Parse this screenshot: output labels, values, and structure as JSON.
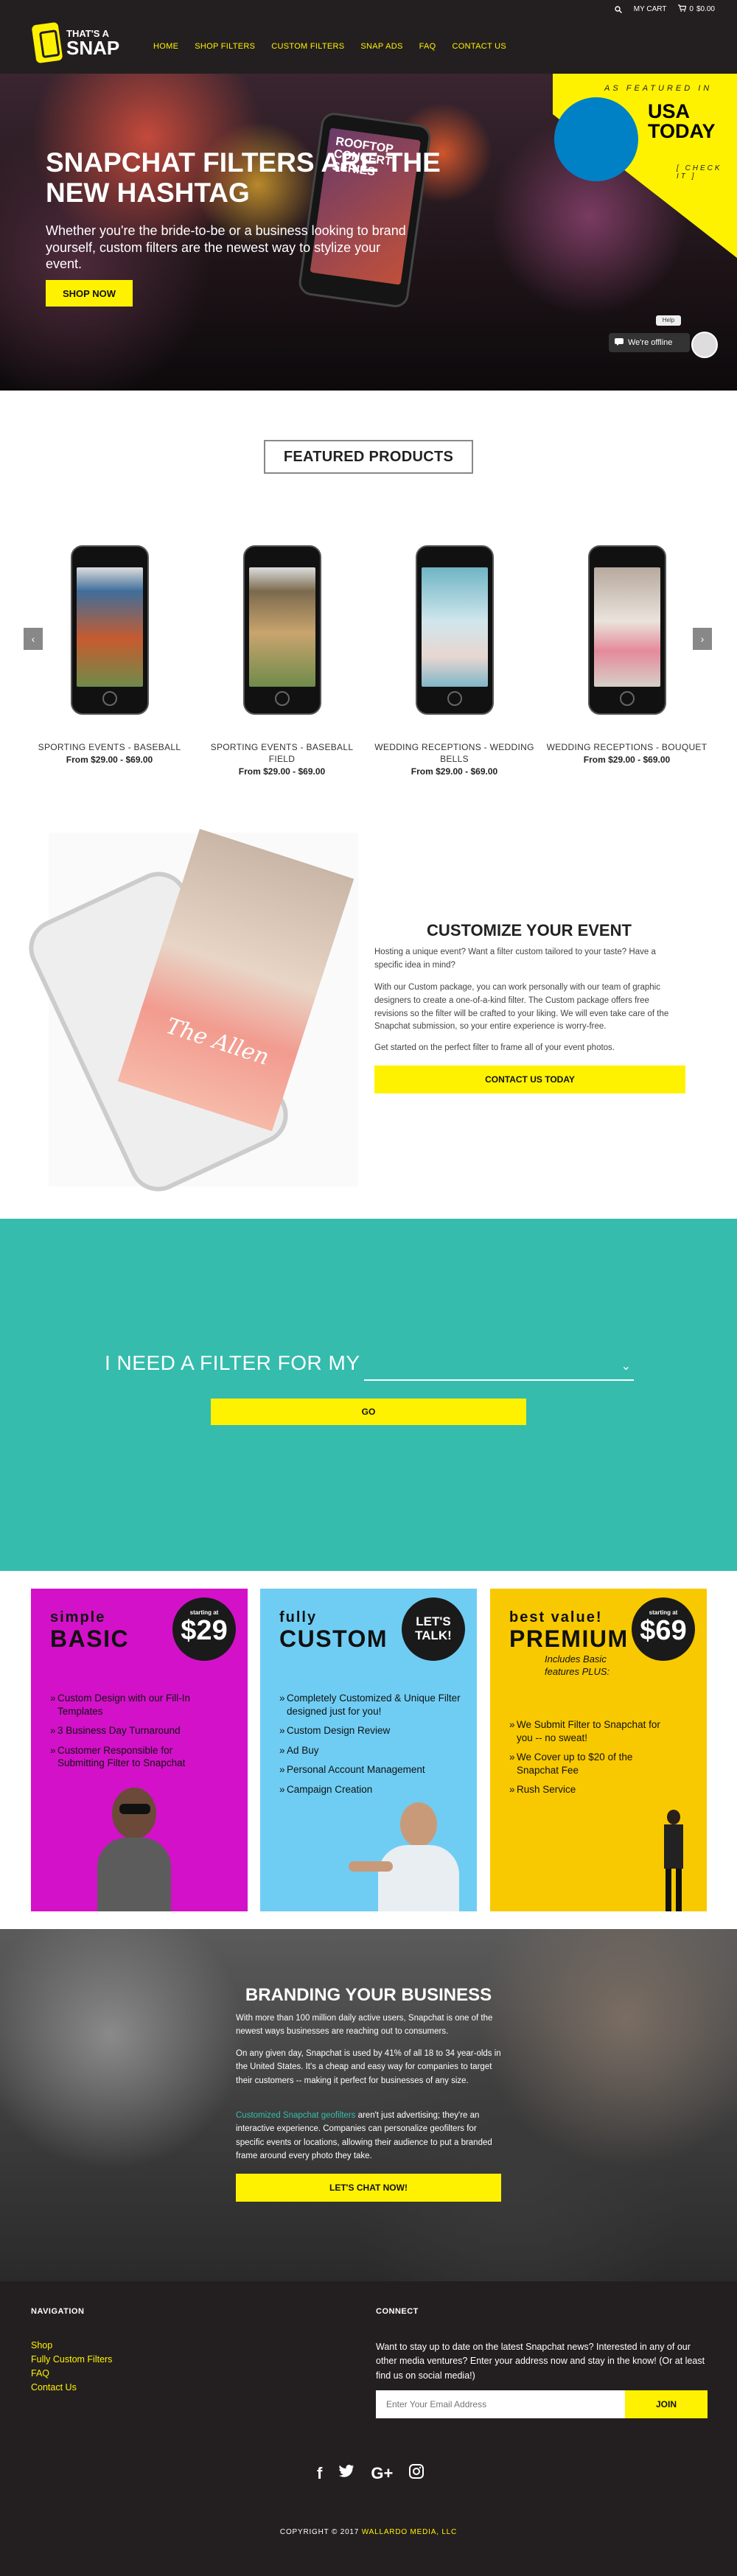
{
  "header": {
    "utility": {
      "my_cart": "MY CART",
      "cart_count": "0",
      "cart_total": "$0.00"
    },
    "logo": {
      "line1": "THAT'S A",
      "line2": "SNAP"
    },
    "nav": [
      "HOME",
      "SHOP FILTERS",
      "CUSTOM FILTERS",
      "SNAP ADS",
      "FAQ",
      "CONTACT US"
    ]
  },
  "hero": {
    "phone_text": "ROOFTOP CONCERT SERIES",
    "title": "SNAPCHAT FILTERS ARE THE NEW HASHTAG",
    "subtitle": "Whether you're the bride-to-be or a business looking to brand yourself, custom filters are the newest way to stylize your event.",
    "cta": "SHOP NOW",
    "badge": {
      "featured": "AS FEATURED IN",
      "logo": "USA TODAY",
      "check": "CHECK IT"
    },
    "chat": {
      "status": "We're offline",
      "help": "Help"
    }
  },
  "featured": {
    "title": "FEATURED PRODUCTS",
    "products": [
      {
        "name": "SPORTING EVENTS - BASEBALL",
        "price": "From $29.00 - $69.00",
        "color": "#3f6e9a"
      },
      {
        "name": "SPORTING EVENTS - BASEBALL FIELD",
        "price": "From $29.00 - $69.00",
        "color": "#7b6a4e"
      },
      {
        "name": "WEDDING RECEPTIONS - WEDDING BELLS",
        "price": "From $29.00 - $69.00",
        "color": "#6fb4c4"
      },
      {
        "name": "WEDDING RECEPTIONS - BOUQUET",
        "price": "From $29.00 - $69.00",
        "color": "#b7a99d"
      }
    ]
  },
  "customize": {
    "title": "CUSTOMIZE YOUR EVENT",
    "p1": "Hosting a unique event? Want a filter custom tailored to your taste? Have a specific idea in mind?",
    "p2": "With our Custom package, you can work personally with our team of graphic designers to create a one-of-a-kind filter. The Custom package offers free revisions so the filter will be crafted to your liking. We will even take care of the Snapchat submission, so your entire experience is worry-free.",
    "p3": "Get started on the perfect filter to frame all of your event photos.",
    "cta": "CONTACT US TODAY",
    "card_text": "The Allen"
  },
  "filter_picker": {
    "label": "I NEED A FILTER FOR MY",
    "selected": "",
    "go": "GO"
  },
  "pricing": {
    "basic": {
      "small": "simple",
      "big": "BASIC",
      "starting": "starting at",
      "amount": "$29",
      "features": [
        "Custom Design with our Fill-In Templates",
        "3 Business Day Turnaround",
        "Customer Responsible for Submitting Filter to Snapchat"
      ]
    },
    "custom": {
      "small": "fully",
      "big": "CUSTOM",
      "badge": "LET'S TALK!",
      "features": [
        "Completely Customized & Unique Filter designed just for you!",
        "Custom Design Review",
        "Ad Buy",
        "Personal Account Management",
        "Campaign Creation"
      ]
    },
    "premium": {
      "small": "best value!",
      "big": "PREMIUM",
      "starting": "starting at",
      "amount": "$69",
      "includes": "Includes Basic features PLUS:",
      "features": [
        "We Submit Filter to Snapchat for you -- no sweat!",
        "We Cover up to $20 of the Snapchat Fee",
        "Rush Service"
      ]
    }
  },
  "branding": {
    "title": "BRANDING YOUR BUSINESS",
    "p1": "With more than 100 million daily active users, Snapchat is one of the newest ways businesses are reaching out to consumers.",
    "p2": "On any given day, Snapchat is used by 41% of all 18 to 34 year-olds in the United States. It's a cheap and easy way for companies to target their customers -- making it perfect for businesses of any size.",
    "p3_link": "Customized Snapchat geofilters",
    "p3_rest": " aren't just advertising; they're an interactive experience. Companies can personalize geofilters for specific events or locations, allowing their audience to put a branded frame around every photo they take.",
    "cta": "LET'S CHAT NOW!"
  },
  "footer": {
    "nav_heading": "NAVIGATION",
    "nav_links": [
      "Shop",
      "Fully Custom Filters",
      "FAQ",
      "Contact Us"
    ],
    "connect_heading": "CONNECT",
    "connect_text": "Want to stay up to date on the latest Snapchat news? Interested in any of our other media ventures? Enter your address now and stay in the know! (Or at least find us on social media!)",
    "email_placeholder": "Enter Your Email Address",
    "join": "JOIN",
    "social": [
      "f",
      "t",
      "G+",
      "ig"
    ],
    "copyright_prefix": "COPYRIGHT © 2017",
    "copyright_company": "WALLARDO MEDIA, LLC"
  },
  "colors": {
    "accent": "#fff200",
    "teal": "#35bcad",
    "basic": "#d311c9",
    "custom": "#6fcdf4",
    "premium": "#f8c900",
    "dark": "#231f20"
  }
}
